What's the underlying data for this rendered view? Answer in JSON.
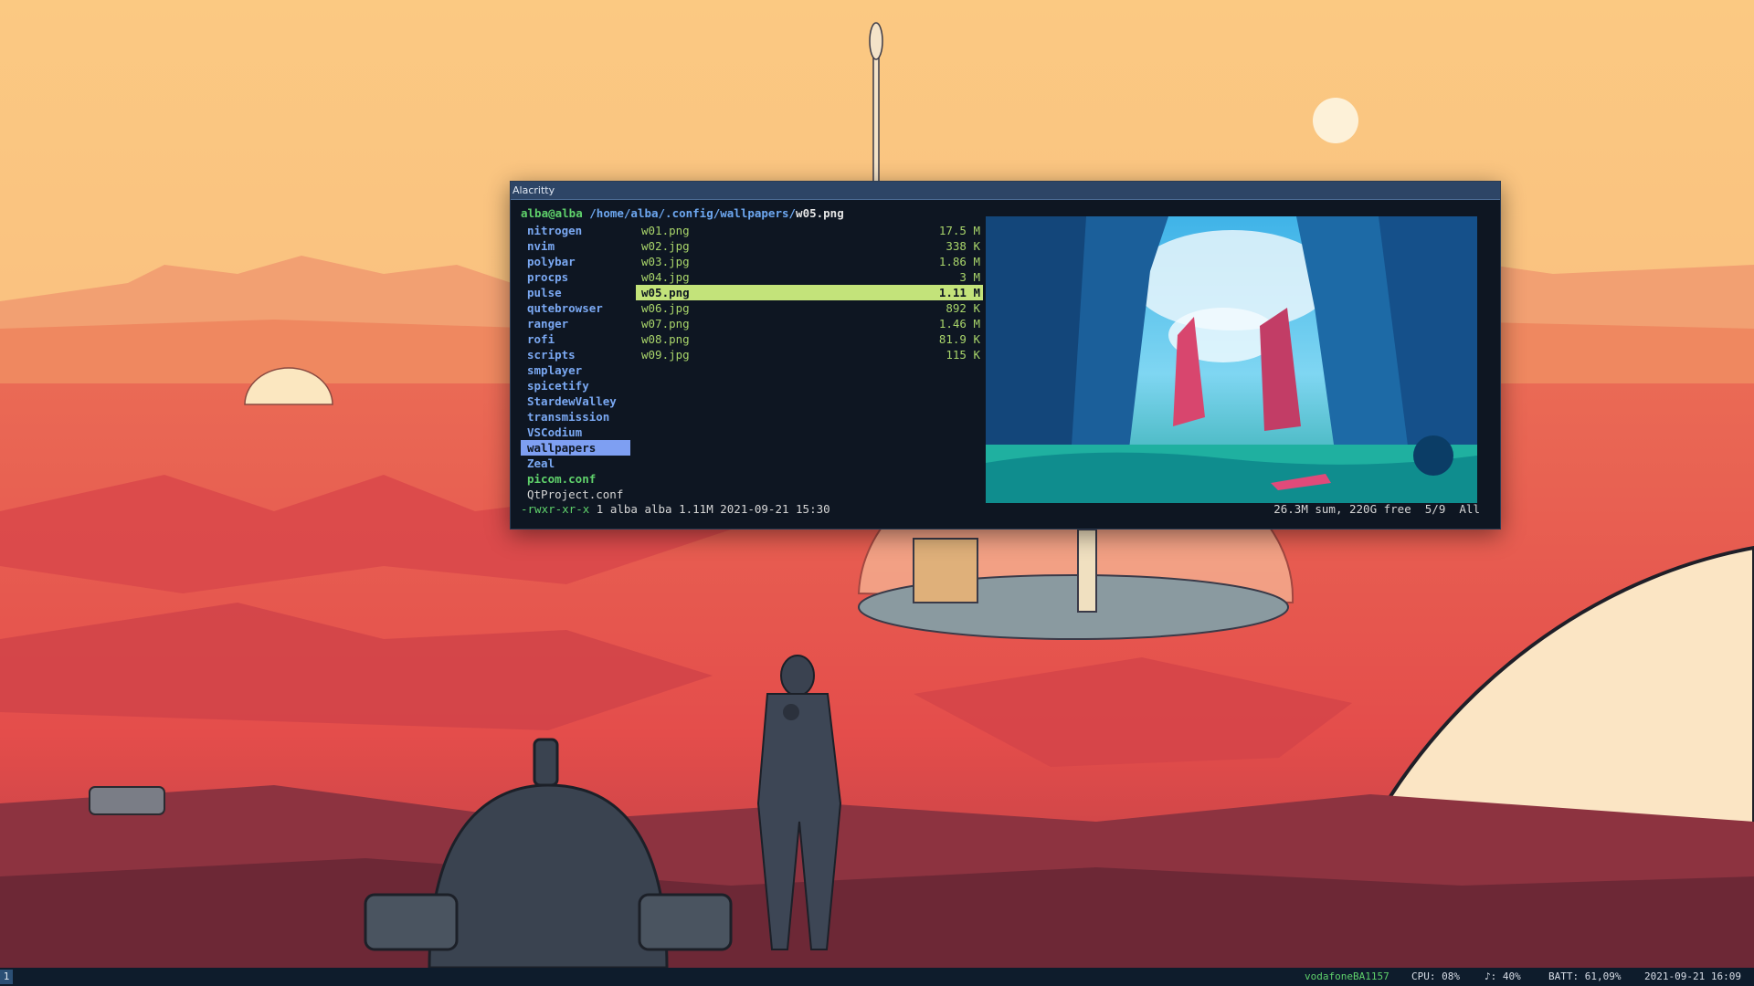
{
  "window": {
    "title": "Alacritty"
  },
  "prompt": {
    "user": "alba@alba",
    "path": "/home/alba/.config/wallpapers/",
    "file": "w05.png"
  },
  "dirs": [
    {
      "label": "nitrogen"
    },
    {
      "label": "nvim"
    },
    {
      "label": "polybar"
    },
    {
      "label": "procps"
    },
    {
      "label": "pulse"
    },
    {
      "label": "qutebrowser"
    },
    {
      "label": "ranger"
    },
    {
      "label": "rofi"
    },
    {
      "label": "scripts"
    },
    {
      "label": "smplayer"
    },
    {
      "label": "spicetify"
    },
    {
      "label": "StardewValley"
    },
    {
      "label": "transmission"
    },
    {
      "label": "VSCodium"
    },
    {
      "label": "wallpapers"
    },
    {
      "label": "Zeal"
    },
    {
      "label": "picom.conf"
    },
    {
      "label": "QtProject.conf"
    }
  ],
  "files": [
    {
      "name": "w01.png",
      "size": "17.5 M"
    },
    {
      "name": "w02.jpg",
      "size": "338 K"
    },
    {
      "name": "w03.jpg",
      "size": "1.86 M"
    },
    {
      "name": "w04.jpg",
      "size": "3 M"
    },
    {
      "name": "w05.png",
      "size": "1.11 M"
    },
    {
      "name": "w06.jpg",
      "size": "892 K"
    },
    {
      "name": "w07.png",
      "size": "1.46 M"
    },
    {
      "name": "w08.png",
      "size": "81.9 K"
    },
    {
      "name": "w09.jpg",
      "size": "115 K"
    }
  ],
  "status": {
    "perms": "-rwxr-xr-x",
    "info": " 1 alba alba 1.11M 2021-09-21 15:30",
    "summary": "26.3M sum, 220G free  5/9  All"
  },
  "bar": {
    "workspace": "1",
    "wifi": "vodafoneBA1157",
    "cpu": "CPU: 08%",
    "volume": "♪: 40%",
    "battery": "BATT: 61,09%",
    "clock": "2021-09-21 16:09"
  }
}
